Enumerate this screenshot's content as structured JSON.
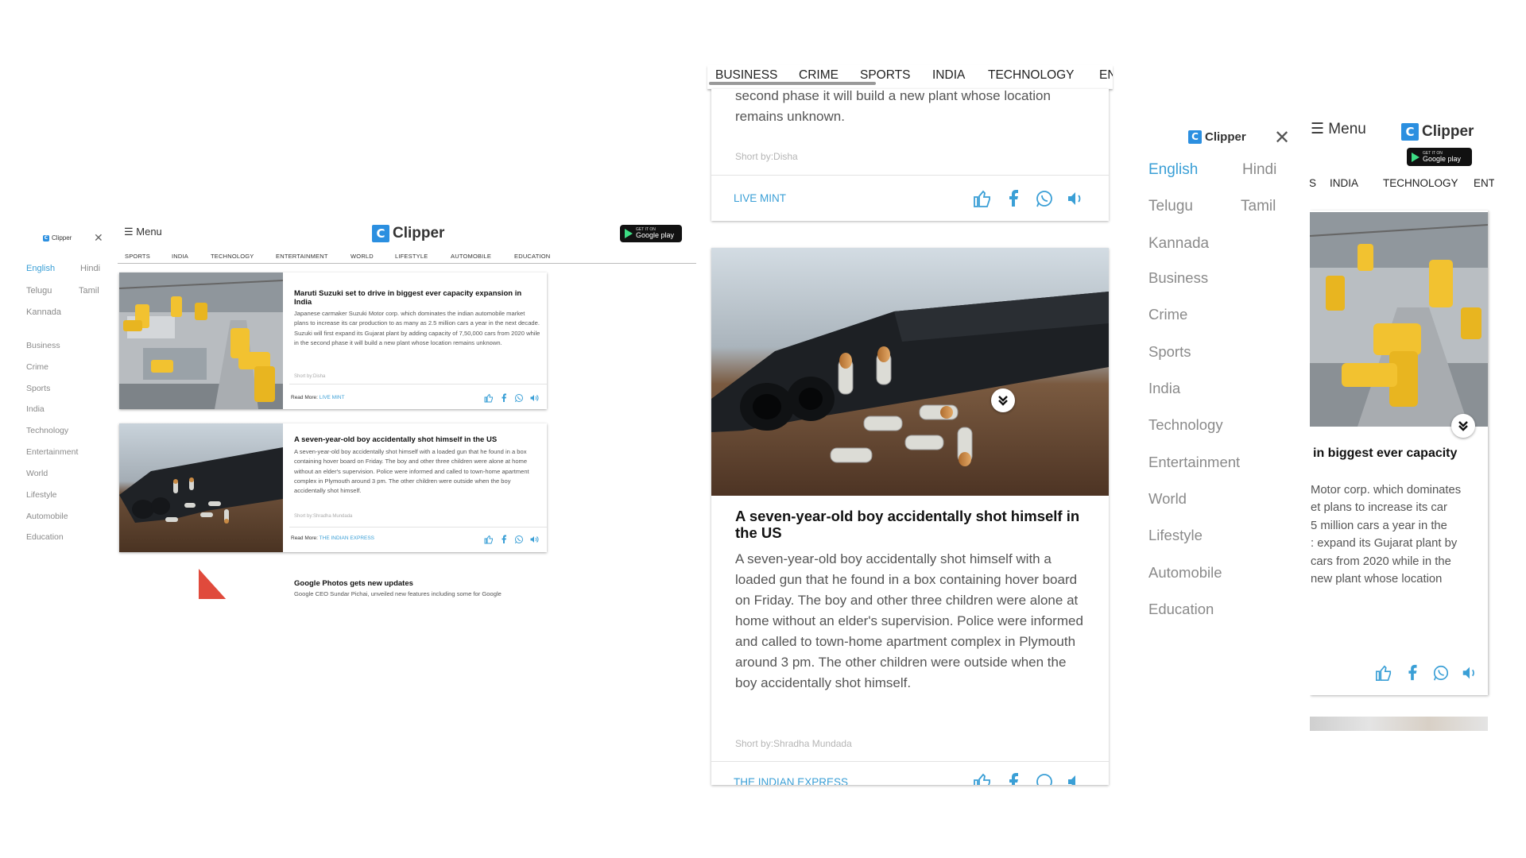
{
  "brand": {
    "logo_letter": "C",
    "name": "Clipper"
  },
  "menu_label": "☰ Menu",
  "google_play": {
    "small": "GET IT ON",
    "big": "Google play"
  },
  "languages": [
    "English",
    "Hindi",
    "Telugu",
    "Tamil",
    "Kannada"
  ],
  "categories": [
    "Business",
    "Crime",
    "Sports",
    "India",
    "Technology",
    "Entertainment",
    "World",
    "Lifestyle",
    "Automobile",
    "Education"
  ],
  "desktop_nav": [
    "SPORTS",
    "INDIA",
    "TECHNOLOGY",
    "ENTERTAINMENT",
    "WORLD",
    "LIFESTYLE",
    "AUTOMOBILE",
    "EDUCATION"
  ],
  "mobile_nav": [
    "BUSINESS",
    "CRIME",
    "SPORTS",
    "INDIA",
    "TECHNOLOGY",
    "ENT"
  ],
  "partial_nav": [
    "S",
    "INDIA",
    "TECHNOLOGY",
    "ENT"
  ],
  "read_more_label": "Read More:",
  "articles": [
    {
      "title": "Maruti Suzuki set to drive in biggest ever capacity expansion in India",
      "body": "Japanese carmaker Suzuki Motor corp. which dominates the indian automobile market plans to increase its car production to as many as 2.5 million cars a year in the next decade. Suzuki will first expand its Gujarat plant by adding capacity of 7,50,000 cars from 2020 while in the second phase it will build a new plant whose location remains unknown.",
      "short_by": "Short by:Disha",
      "source": "LIVE MINT"
    },
    {
      "title": "A seven-year-old boy accidentally shot himself in the US",
      "body": "A seven-year-old boy accidentally shot himself with a loaded gun that he found in a box containing hover board on Friday. The boy and other three children were alone at home without an elder's supervision. Police were informed and called to town-home apartment complex in Plymouth around 3 pm. The other children were outside when the boy accidentally shot himself.",
      "short_by": "Short by:Shradha Mundada",
      "source": "THE INDIAN EXPRESS"
    },
    {
      "title": "Google Photos gets new updates",
      "body": "Google CEO Sundar Pichai, unveiled new features including some for Google"
    }
  ],
  "mobile_top_card": {
    "line1": "second phase it will build a new plant whose location",
    "line2": "remains unknown.",
    "short_by": "Short by:Disha",
    "source": "LIVE MINT"
  },
  "partial_card": {
    "title": "in biggest ever capacity",
    "lines": [
      "Motor corp. which dominates",
      "et plans to increase its car",
      "5 million cars a year in the",
      ": expand its Gujarat plant by",
      "cars from 2020 while in the",
      "new plant whose location"
    ]
  },
  "colors": {
    "accent": "#3a9fd6",
    "logo": "#2b8fe0",
    "robot_yellow": "#f2c230"
  },
  "icons": [
    "thumbs-up-icon",
    "facebook-icon",
    "whatsapp-icon",
    "speaker-icon",
    "close-icon",
    "chevron-double-down-icon",
    "play-store-icon"
  ]
}
